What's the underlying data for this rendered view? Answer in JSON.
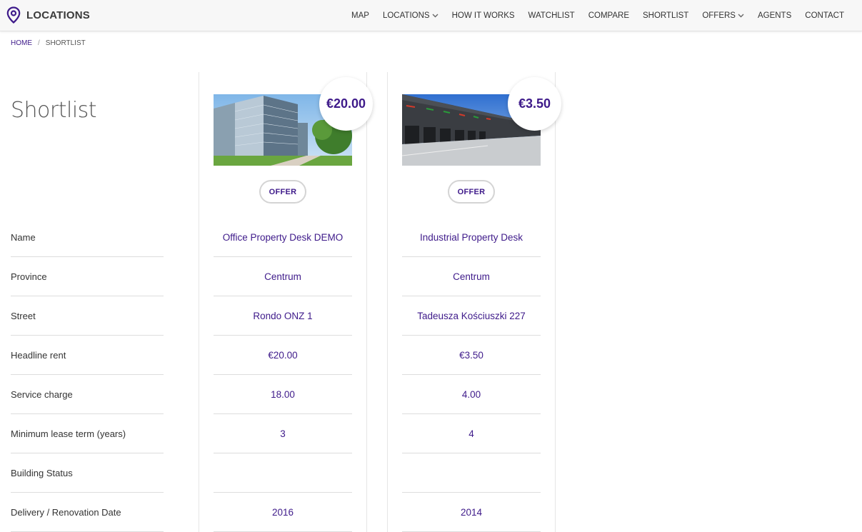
{
  "brand": {
    "name": "LOCATIONS",
    "icon": "map-pin-icon",
    "accent": "#3e1a8a"
  },
  "nav": [
    {
      "label": "MAP"
    },
    {
      "label": "LOCATIONS",
      "dropdown": true
    },
    {
      "label": "HOW IT WORKS"
    },
    {
      "label": "WATCHLIST"
    },
    {
      "label": "COMPARE"
    },
    {
      "label": "SHORTLIST"
    },
    {
      "label": "OFFERS",
      "dropdown": true
    },
    {
      "label": "AGENTS"
    },
    {
      "label": "CONTACT"
    }
  ],
  "breadcrumb": {
    "home": "HOME",
    "separator": "/",
    "current": "SHORTLIST"
  },
  "title": "Shortlist",
  "row_labels": [
    "Name",
    "Province",
    "Street",
    "Headline rent",
    "Service charge",
    "Minimum lease term (years)",
    "Building Status",
    "Delivery / Renovation Date"
  ],
  "properties": [
    {
      "price": "€20.00",
      "offer_label": "OFFER",
      "image": "office-building-photo",
      "values": [
        "Office Property Desk DEMO",
        "Centrum",
        "Rondo ONZ 1",
        "€20.00",
        "18.00",
        "3",
        "",
        "2016"
      ]
    },
    {
      "price": "€3.50",
      "offer_label": "OFFER",
      "image": "industrial-warehouse-photo",
      "values": [
        "Industrial Property Desk",
        "Centrum",
        "Tadeusza Kościuszki 227",
        "€3.50",
        "4.00",
        "4",
        "",
        "2014"
      ]
    }
  ]
}
